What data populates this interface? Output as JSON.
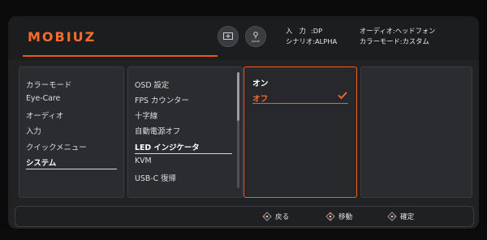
{
  "brand": {
    "logo": "MOBIUZ"
  },
  "header": {
    "icons": [
      "crosshair-icon",
      "eye-care-icon"
    ],
    "icon_caption": "ʃʌʀʀE",
    "info": {
      "input_label": "入　力",
      "input_value": ":DP",
      "scenario_label": "シナリオ",
      "scenario_value": ":ALPHA",
      "audio_label": "オーディオ",
      "audio_value": ":ヘッドフォン",
      "colormode_label": "カラーモード",
      "colormode_value": ":カスタム"
    }
  },
  "menu1": {
    "items": [
      "カラーモード",
      "Eye-Care",
      "オーディオ",
      "入力",
      "クイックメニュー",
      "システム"
    ],
    "selected": "システム"
  },
  "menu2": {
    "items": [
      "OSD 設定",
      "FPS カウンター",
      "十字線",
      "自動電源オフ",
      "LED インジケータ",
      "KVM",
      "USB-C 復帰"
    ],
    "selected": "LED インジケータ"
  },
  "menu3": {
    "options": [
      "オン",
      "オフ"
    ],
    "selected": "オフ"
  },
  "footer": {
    "back": "戻る",
    "move": "移動",
    "confirm": "確定"
  },
  "colors": {
    "accent": "#ff5a1f",
    "panel": "#2a2c2f",
    "background": "#202224"
  }
}
